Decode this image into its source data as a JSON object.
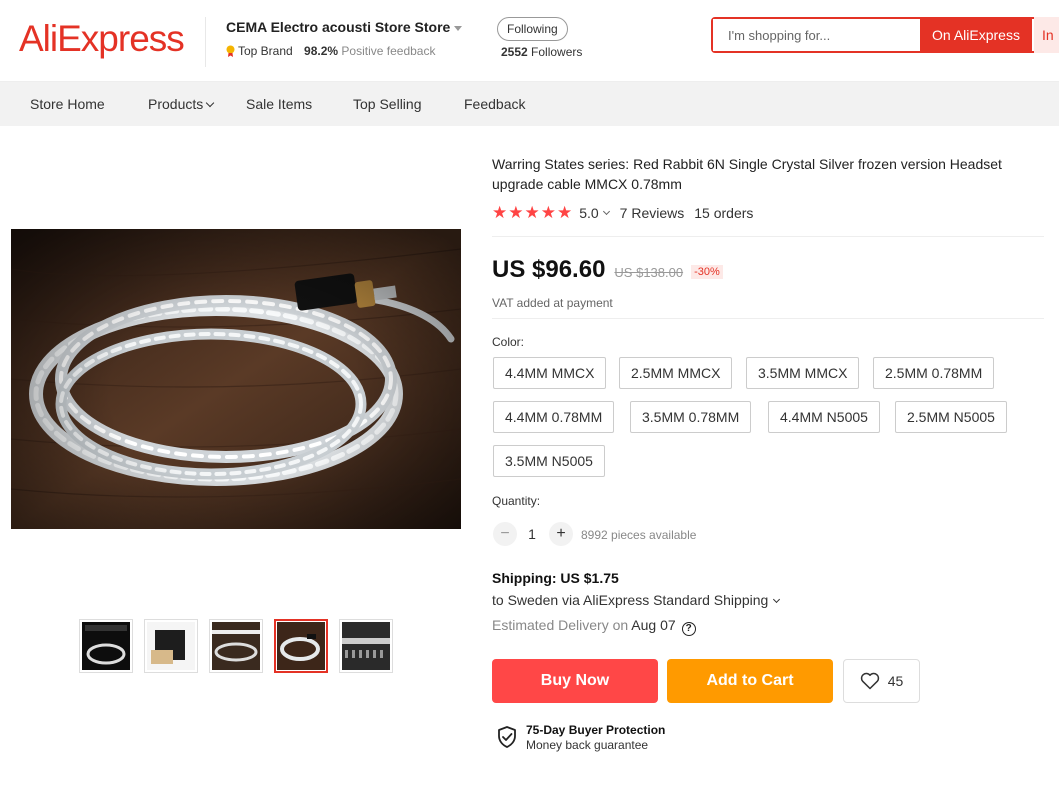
{
  "brand": {
    "logo_text": "AliExpress",
    "color": "#e43225"
  },
  "store": {
    "name": "CEMA Electro acousti Store Store",
    "badge": "Top Brand",
    "feedback_pct": "98.2%",
    "feedback_label": "Positive feedback",
    "follow_label": "Following",
    "followers_count": "2552",
    "followers_label": "Followers"
  },
  "search": {
    "placeholder": "I'm shopping for...",
    "button_label": "On AliExpress",
    "button2_label": "In"
  },
  "nav": {
    "items": [
      {
        "label": "Store Home"
      },
      {
        "label": "Products"
      },
      {
        "label": "Sale Items"
      },
      {
        "label": "Top Selling"
      },
      {
        "label": "Feedback"
      }
    ]
  },
  "product": {
    "title": "Warring States series: Red Rabbit 6N Single Crystal Silver frozen version Headset upgrade cable MMCX 0.78mm",
    "stars": "★★★★★",
    "rating": "5.0",
    "reviews": "7 Reviews",
    "orders": "15 orders",
    "price": "US $96.60",
    "old_price": "US $138.00",
    "discount": "-30%",
    "vat_note": "VAT added at payment",
    "color_label": "Color:",
    "colors": [
      "4.4MM MMCX",
      "2.5MM MMCX",
      "3.5MM MMCX",
      "2.5MM 0.78MM",
      "4.4MM 0.78MM",
      "3.5MM 0.78MM",
      "4.4MM N5005",
      "2.5MM N5005",
      "3.5MM N5005"
    ],
    "quantity_label": "Quantity:",
    "quantity": "1",
    "minus": "−",
    "plus": "+",
    "available": "8992 pieces available",
    "thumbnail_count": 5,
    "active_thumbnail": 4
  },
  "shipping": {
    "title": "Shipping: US $1.75",
    "destination": "to Sweden via AliExpress Standard Shipping",
    "estimate_label": "Estimated Delivery on",
    "estimate_date": "Aug 07",
    "help_icon": "?"
  },
  "actions": {
    "buy_label": "Buy Now",
    "cart_label": "Add to Cart",
    "wishlist_count": "45",
    "buy_color": "#ff4747",
    "cart_color": "#ff9a00"
  },
  "protection": {
    "title": "75-Day Buyer Protection",
    "subtitle": "Money back guarantee"
  }
}
